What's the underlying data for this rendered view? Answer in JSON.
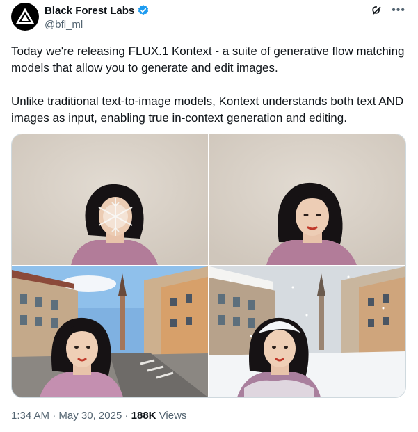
{
  "author": {
    "name": "Black Forest Labs",
    "handle": "@bfl_ml",
    "verified_color": "#1d9bf0"
  },
  "tweet": {
    "paragraph1": "Today we're releasing FLUX.1 Kontext - a suite of generative flow matching models that allow you to generate and edit images.",
    "paragraph2": "Unlike traditional text-to-image models, Kontext understands both text AND images as input, enabling true in-context generation and editing."
  },
  "media": {
    "images": [
      {
        "icon": "woman-snowflake-face-image"
      },
      {
        "icon": "woman-portrait-image"
      },
      {
        "icon": "woman-street-selfie-image"
      },
      {
        "icon": "woman-snowy-street-image"
      }
    ]
  },
  "meta": {
    "time": "1:34 AM",
    "date": "May 30, 2025",
    "separator": "·",
    "views_count": "188K",
    "views_label": "Views"
  },
  "icons": [
    "grok-icon",
    "more-options-icon",
    "verified-badge-icon",
    "bfl-logo-icon"
  ]
}
